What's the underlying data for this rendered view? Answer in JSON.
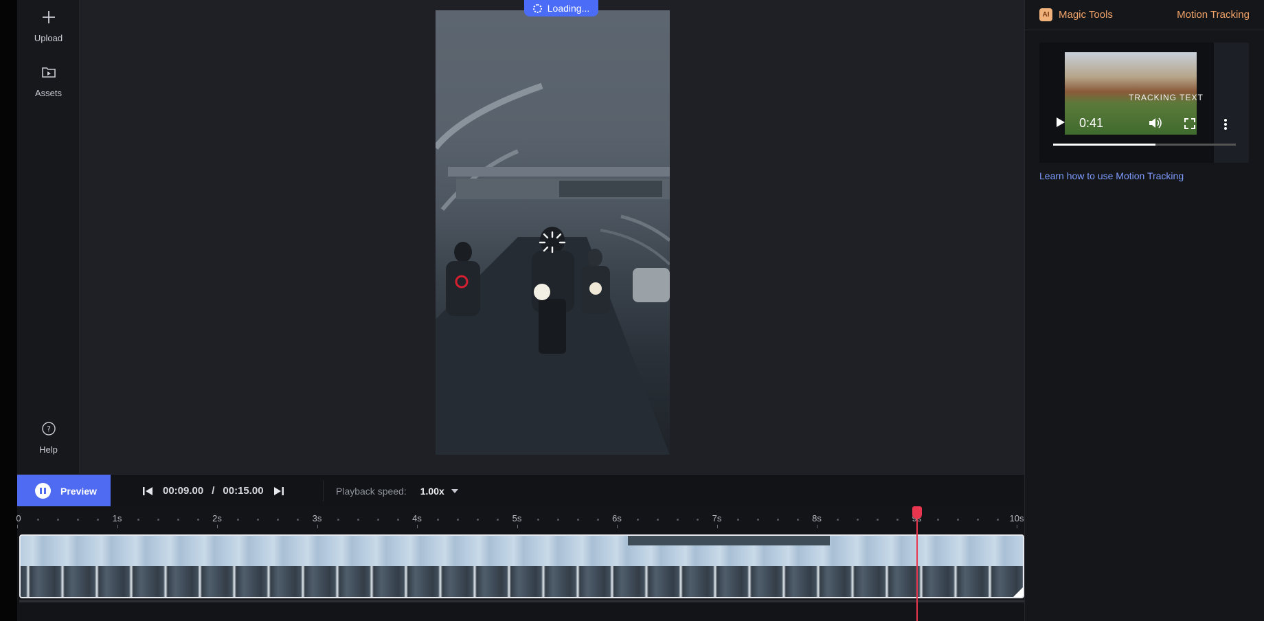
{
  "sidebar": {
    "upload_label": "Upload",
    "assets_label": "Assets",
    "help_label": "Help"
  },
  "stage": {
    "loading_label": "Loading..."
  },
  "panel": {
    "ai_badge": "AI",
    "title": "Magic Tools",
    "tool_name": "Motion Tracking",
    "tutorial": {
      "caption": "TRACKING TEXT",
      "time": "0:41",
      "progress": 0.56
    },
    "learn_link": "Learn how to use Motion Tracking"
  },
  "transport": {
    "preview_label": "Preview",
    "current_time": "00:09.00",
    "time_separator": "/",
    "total_time": "00:15.00",
    "speed_label": "Playback speed:",
    "speed_value": "1.00x"
  },
  "timeline": {
    "ticks": [
      "0",
      "1s",
      "2s",
      "3s",
      "4s",
      "5s",
      "6s",
      "7s",
      "8s",
      "9s",
      "10s"
    ],
    "playhead_seconds": 9
  },
  "colors": {
    "accent": "#4e6bf2",
    "playhead": "#e8364f",
    "magic_orange": "#f2a368",
    "link_blue": "#7f9cff"
  }
}
